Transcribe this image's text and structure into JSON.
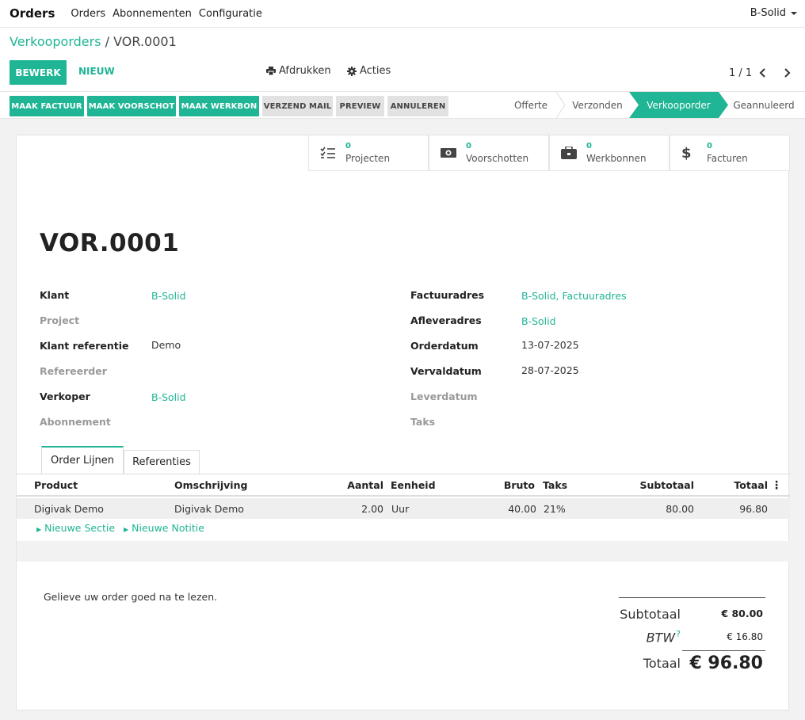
{
  "navbar": {
    "brand": "Orders",
    "menu": [
      "Orders",
      "Abonnementen",
      "Configuratie"
    ],
    "company": "B-Solid"
  },
  "breadcrumb": {
    "parent": "Verkooporders",
    "separator": "/",
    "current": "VOR.0001"
  },
  "control": {
    "edit_label": "BEWERK",
    "new_label": "NIEUW",
    "print_label": "Afdrukken",
    "actions_label": "Acties",
    "pager": "1 / 1"
  },
  "status_buttons": [
    {
      "label": "MAAK FACTUUR",
      "style": "green"
    },
    {
      "label": "MAAK VOORSCHOT",
      "style": "green"
    },
    {
      "label": "MAAK WERKBON",
      "style": "green"
    },
    {
      "label": "VERZEND MAIL",
      "style": "grey"
    },
    {
      "label": "PREVIEW",
      "style": "grey"
    },
    {
      "label": "ANNULEREN",
      "style": "grey"
    }
  ],
  "stages": [
    {
      "label": "Offerte",
      "active": false
    },
    {
      "label": "Verzonden",
      "active": false
    },
    {
      "label": "Verkooporder",
      "active": true
    },
    {
      "label": "Geannuleerd",
      "active": false
    }
  ],
  "smart_buttons": [
    {
      "count": "0",
      "label": "Projecten",
      "icon": "tasks-icon"
    },
    {
      "count": "0",
      "label": "Voorschotten",
      "icon": "money-icon"
    },
    {
      "count": "0",
      "label": "Werkbonnen",
      "icon": "briefcase-icon"
    },
    {
      "count": "0",
      "label": "Facturen",
      "icon": "dollar-icon"
    }
  ],
  "record": {
    "name": "VOR.0001",
    "left_fields": [
      {
        "label": "Klant",
        "value": "B-Solid",
        "required": true,
        "link": true
      },
      {
        "label": "Project",
        "value": "",
        "required": false,
        "link": false
      },
      {
        "label": "Klant referentie",
        "value": "Demo",
        "required": true,
        "link": false
      },
      {
        "label": "Refereerder",
        "value": "",
        "required": false,
        "link": false
      },
      {
        "label": "Verkoper",
        "value": "B-Solid",
        "required": true,
        "link": true
      },
      {
        "label": "Abonnement",
        "value": "",
        "required": false,
        "link": false
      }
    ],
    "right_fields": [
      {
        "label": "Factuuradres",
        "value": "B-Solid, Factuuradres",
        "required": true,
        "link": true
      },
      {
        "label": "Afleveradres",
        "value": "B-Solid",
        "required": true,
        "link": true
      },
      {
        "label": "Orderdatum",
        "value": "13-07-2025",
        "required": true,
        "link": false
      },
      {
        "label": "Vervaldatum",
        "value": "28-07-2025",
        "required": true,
        "link": false
      },
      {
        "label": "Leverdatum",
        "value": "",
        "required": false,
        "link": false
      },
      {
        "label": "Taks",
        "value": "",
        "required": false,
        "link": false
      }
    ]
  },
  "tabs": [
    {
      "label": "Order Lijnen",
      "active": true
    },
    {
      "label": "Referenties",
      "active": false
    }
  ],
  "table": {
    "headers": {
      "product": "Product",
      "description": "Omschrijving",
      "quantity": "Aantal",
      "unit": "Eenheid",
      "gross": "Bruto",
      "tax": "Taks",
      "subtotal": "Subtotaal",
      "total": "Totaal"
    },
    "rows": [
      {
        "product": "Digivak Demo",
        "description": "Digivak Demo",
        "quantity": "2.00",
        "unit": "Uur",
        "gross": "40.00",
        "tax": "21%",
        "subtotal": "80.00",
        "total": "96.80"
      }
    ],
    "add_section": "Nieuwe Sectie",
    "add_note": "Nieuwe Notitie"
  },
  "footer": {
    "note": "Gelieve uw order goed na te lezen.",
    "subtotal_label": "Subtotaal",
    "subtotal_value": "€ 80.00",
    "tax_label": "BTW",
    "tax_help": "?",
    "tax_value": "€ 16.80",
    "total_label": "Totaal",
    "total_value": "€ 96.80"
  },
  "colors": {
    "accent": "#1fb595",
    "grey_button": "#e2e2e2"
  }
}
